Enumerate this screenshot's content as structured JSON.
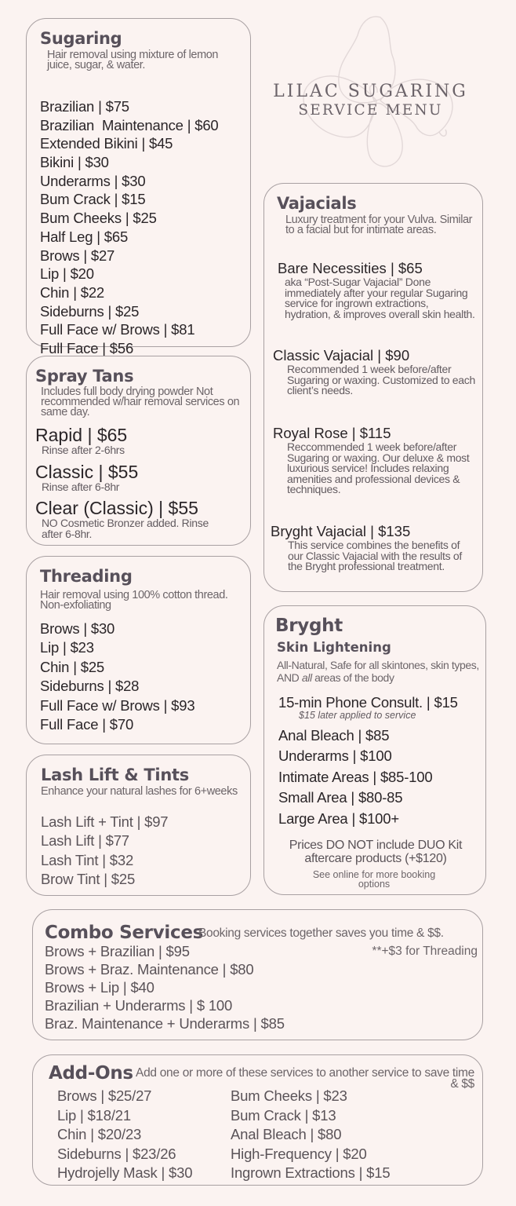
{
  "header": {
    "title_line1": "LILAC SUGARING",
    "title_line2": "SERVICE MENU",
    "logo_icon": "flower-outline-icon"
  },
  "sugaring": {
    "title": "Sugaring",
    "description": "Hair removal using mixture of lemon juice, sugar, & water.",
    "items": [
      "Brazilian | $75",
      "Brazilian  Maintenance | $60",
      "Extended Bikini | $45",
      "Bikini | $30",
      "Underarms | $30",
      "Bum Crack | $15",
      "Bum Cheeks | $25",
      "Half Leg | $65",
      "Brows | $27",
      "Lip | $20",
      "Chin | $22",
      "Sideburns | $25",
      "Full Face w/ Brows | $81",
      "Full Face | $56"
    ]
  },
  "spray_tans": {
    "title": "Spray Tans",
    "description": "Includes full body drying powder Not recommended w/hair removal services on same day.",
    "items": [
      {
        "name": "Rapid | $65",
        "note": "Rinse after 2-6hrs"
      },
      {
        "name": "Classic | $55",
        "note": "Rinse after 6-8hr"
      },
      {
        "name": "Clear (Classic) | $55",
        "note": "NO Cosmetic Bronzer added. Rinse after 6-8hr."
      }
    ]
  },
  "threading": {
    "title": "Threading",
    "description": "Hair removal using 100% cotton thread. Non-exfoliating",
    "items": [
      "Brows | $30",
      "Lip | $23",
      "Chin | $25",
      "Sideburns | $28",
      "Full Face w/ Brows | $93",
      "Full Face | $70"
    ]
  },
  "lash": {
    "title": "Lash Lift & Tints",
    "description": "Enhance your natural lashes for 6+weeks",
    "items": [
      "Lash Lift + Tint | $97",
      "Lash Lift | $77",
      "Lash Tint | $32",
      "Brow Tint | $25"
    ]
  },
  "vajacials": {
    "title": "Vajacials",
    "description": "Luxury treatment for your Vulva. Similar to a facial but for intimate areas.",
    "items": [
      {
        "name": "Bare Necessities | $65",
        "note": "aka “Post-Sugar Vajacial” Done immediately after your regular Sugaring service for ingrown extractions, hydration, & improves overall skin health."
      },
      {
        "name": "Classic Vajacial | $90",
        "note": "Recommended 1 week before/after Sugaring or waxing. Customized to each client’s needs."
      },
      {
        "name": "Royal Rose | $115",
        "note": "Reccommended 1 week before/after Sugaring or waxing. Our deluxe & most luxurious service! Includes relaxing amenities and professional devices & techniques."
      },
      {
        "name": "Bryght Vajacial | $135",
        "note": "This service combines the benefits of our Classic Vajacial with the results of the Bryght professional treatment."
      }
    ]
  },
  "bryght": {
    "title": "Bryght",
    "subtitle": "Skin Lightening",
    "description_pre": "All-Natural, Safe for all skintones, skin types, AND ",
    "description_em": "all",
    "description_post": " areas of the body",
    "consult": "15-min Phone Consult. | $15",
    "consult_note": "$15 later applied to service",
    "items": [
      "Anal Bleach | $85",
      "Underarms | $100",
      "Intimate Areas | $85-100",
      "Small Area | $80-85",
      "Large Area | $100+"
    ],
    "footnote": "Prices DO NOT include DUO Kit aftercare products (+$120)",
    "online_note": "See online for more booking options"
  },
  "combo": {
    "title": "Combo Services",
    "tagline": "Booking services together saves you time & $$.",
    "threading_note": "**+$3 for Threading",
    "items": [
      "Brows + Brazilian | $95",
      "Brows + Braz. Maintenance | $80",
      "Brows + Lip | $40",
      "Brazilian + Underarms | $ 100",
      "Braz. Maintenance + Underarms | $85"
    ]
  },
  "addons": {
    "title": "Add-Ons",
    "tagline": "Add one or more of these services to another service to save time & $$",
    "col1": [
      "Brows | $25/27",
      "Lip | $18/21",
      "Chin | $20/23",
      "Sideburns | $23/26",
      "Hydrojelly Mask | $30"
    ],
    "col2": [
      "Bum Cheeks | $23",
      "Bum Crack | $13",
      "Anal Bleach | $80",
      "High-Frequency | $20",
      "Ingrown Extractions | $15"
    ]
  }
}
